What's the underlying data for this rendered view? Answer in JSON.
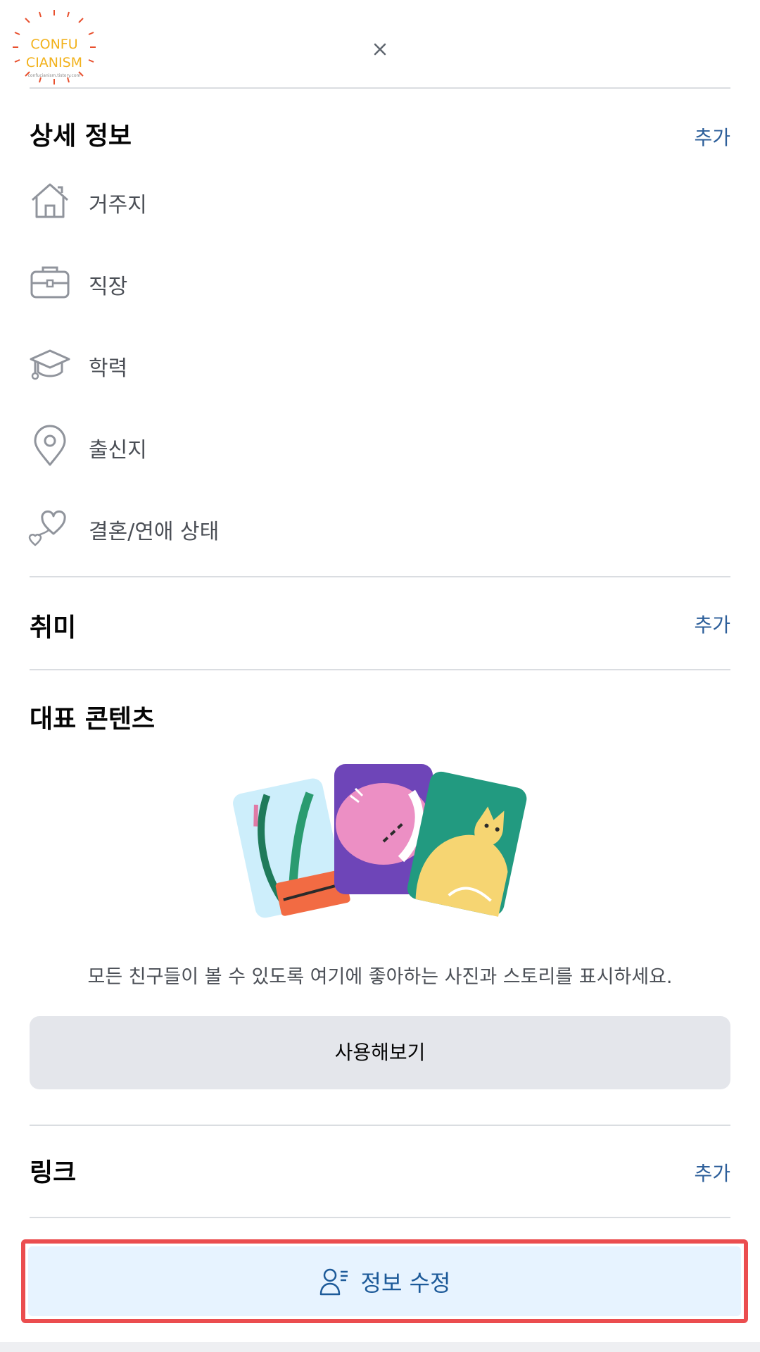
{
  "watermark": {
    "line1": "CONFU",
    "line2": "CIANISM",
    "sub": "confucianism.tistory.com"
  },
  "header": {
    "close_label": "×"
  },
  "details": {
    "title": "상세 정보",
    "add_label": "추가",
    "items": [
      {
        "label": "거주지",
        "icon": "home-icon"
      },
      {
        "label": "직장",
        "icon": "briefcase-icon"
      },
      {
        "label": "학력",
        "icon": "graduation-cap-icon"
      },
      {
        "label": "출신지",
        "icon": "location-pin-icon"
      },
      {
        "label": "결혼/연애 상태",
        "icon": "hearts-icon"
      }
    ]
  },
  "hobbies": {
    "title": "취미",
    "add_label": "추가"
  },
  "featured": {
    "title": "대표 콘텐츠",
    "description": "모든 친구들이 볼 수 있도록 여기에 좋아하는 사진과 스토리를 표시하세요.",
    "try_label": "사용해보기"
  },
  "links": {
    "title": "링크",
    "add_label": "추가"
  },
  "edit": {
    "label": "정보 수정",
    "icon": "person-list-icon"
  },
  "colors": {
    "accent": "#2d5f9a",
    "highlight": "#eb4d4f",
    "edit_bg": "#e7f3ff"
  }
}
